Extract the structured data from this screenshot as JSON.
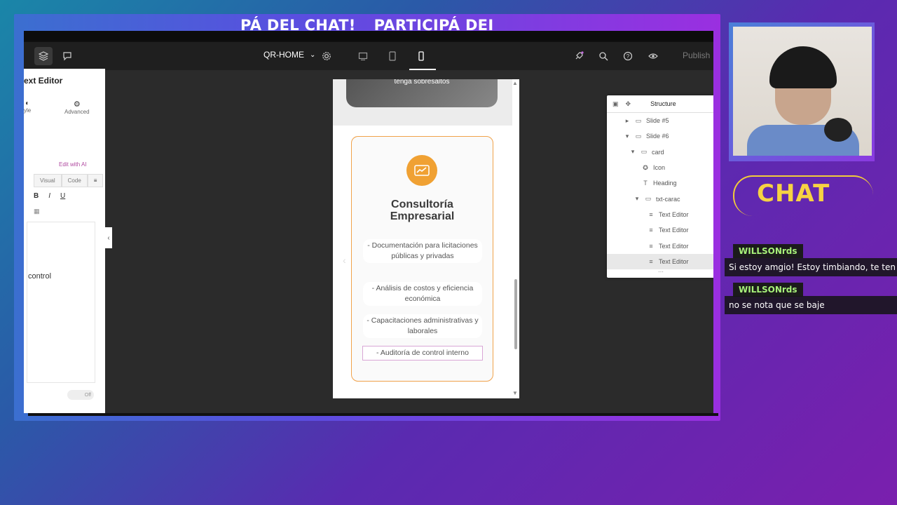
{
  "banner": {
    "text1": "PÁ DEL CHAT!",
    "text2": "PARTICIPÁ DEI"
  },
  "topbar": {
    "page_name": "QR-HOME",
    "publish_label": "Publish",
    "icons": [
      "layers-icon",
      "comments-icon",
      "settings-icon",
      "desktop-icon",
      "tablet-icon",
      "mobile-icon",
      "rocket-icon",
      "search-icon",
      "help-icon",
      "eye-icon"
    ]
  },
  "left_panel": {
    "title": "ext Editor",
    "tab_style": "yle",
    "tab_advanced": "Advanced",
    "edit_with_ai": "Edit with AI",
    "visual_tab": "Visual",
    "code_tab": "Code",
    "format_bold": "B",
    "format_italic": "I",
    "format_underline": "U",
    "content_text": "control",
    "toggle_label": "Off"
  },
  "preview": {
    "top_caption": "tenga sobresaltos",
    "card_title_line1": "Consultoría",
    "card_title_line2": "Empresarial",
    "items": [
      "- Documentación para licitaciones públicas y privadas",
      "- Análisis de costos y eficiencia económica",
      "- Capacitaciones administrativas y laborales",
      "- Auditoría de control interno"
    ],
    "accent_color": "#f0a133"
  },
  "structure": {
    "title": "Structure",
    "rows": [
      {
        "label": "Slide #5",
        "icon": "container-icon",
        "caret": "▸"
      },
      {
        "label": "Slide #6",
        "icon": "container-icon",
        "caret": "▾"
      },
      {
        "label": "card",
        "icon": "container-icon",
        "caret": "▾"
      },
      {
        "label": "Icon",
        "icon": "star-icon",
        "caret": ""
      },
      {
        "label": "Heading",
        "icon": "heading-icon",
        "caret": ""
      },
      {
        "label": "txt-carac",
        "icon": "container-icon",
        "caret": "▾"
      },
      {
        "label": "Text Editor",
        "icon": "text-editor-icon",
        "caret": ""
      },
      {
        "label": "Text Editor",
        "icon": "text-editor-icon",
        "caret": ""
      },
      {
        "label": "Text Editor",
        "icon": "text-editor-icon",
        "caret": ""
      },
      {
        "label": "Text Editor",
        "icon": "text-editor-icon",
        "caret": ""
      }
    ]
  },
  "chat": {
    "logo_text": "CHAT",
    "messages": [
      {
        "user": "WILLSONrds",
        "text": "Si estoy amgio! Estoy timbiando, te ten"
      },
      {
        "user": "WILLSONrds",
        "text": "no se nota que se baje"
      }
    ]
  }
}
